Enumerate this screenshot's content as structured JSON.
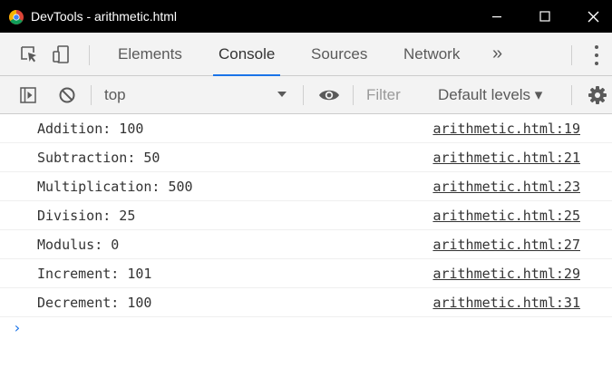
{
  "window": {
    "title": "DevTools - arithmetic.html"
  },
  "tabs": {
    "items": [
      {
        "label": "Elements"
      },
      {
        "label": "Console",
        "selected": true
      },
      {
        "label": "Sources"
      },
      {
        "label": "Network"
      }
    ],
    "more": "»"
  },
  "toolbar": {
    "context": "top",
    "filter_placeholder": "Filter",
    "levels_label": "Default levels ▾"
  },
  "messages": [
    {
      "text": "Addition: 100",
      "source": "arithmetic.html:19"
    },
    {
      "text": "Subtraction: 50",
      "source": "arithmetic.html:21"
    },
    {
      "text": "Multiplication: 500",
      "source": "arithmetic.html:23"
    },
    {
      "text": "Division: 25",
      "source": "arithmetic.html:25"
    },
    {
      "text": "Modulus: 0",
      "source": "arithmetic.html:27"
    },
    {
      "text": "Increment: 101",
      "source": "arithmetic.html:29"
    },
    {
      "text": "Decrement: 100",
      "source": "arithmetic.html:31"
    }
  ],
  "prompt": "›",
  "colors": {
    "accent": "#1a73e8",
    "titlebar": "#000000",
    "toolbar_bg": "#f3f3f3"
  },
  "icons": {
    "app": "chrome-icon",
    "inspect": "inspect-element-icon",
    "device": "device-toggle-icon",
    "sidebar": "show-sidebar-icon",
    "clear": "clear-console-icon",
    "eye": "live-expression-eye-icon",
    "settings": "gear-icon"
  }
}
